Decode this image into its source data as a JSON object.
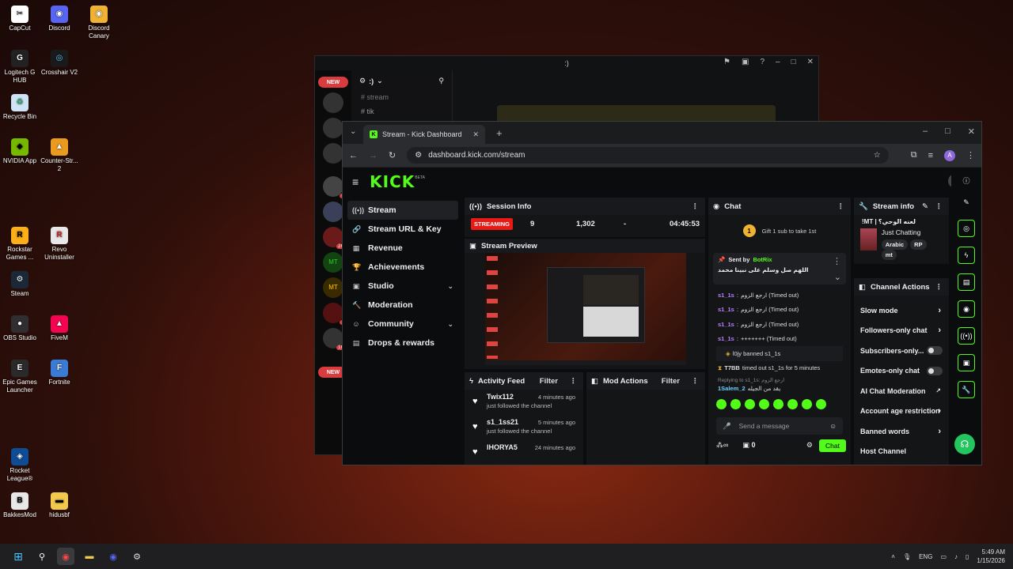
{
  "desktop": {
    "icons": [
      {
        "label": "CapCut",
        "glyph": "✂",
        "color": "#ffffff",
        "fg": "#000"
      },
      {
        "label": "Discord",
        "glyph": "◉",
        "color": "#5865f2",
        "fg": "#fff"
      },
      {
        "label": "Discord Canary",
        "glyph": "◉",
        "color": "#f0b232",
        "fg": "#fff"
      },
      {
        "label": "Logitech G HUB",
        "glyph": "G",
        "color": "#222222",
        "fg": "#fff"
      },
      {
        "label": "Crosshair V2",
        "glyph": "◎",
        "color": "#1a1a1a",
        "fg": "#6cf"
      },
      {
        "label": "Recycle Bin",
        "glyph": "♻",
        "color": "#cfe3f7",
        "fg": "#2a6"
      },
      {
        "label": "NVIDIA App",
        "glyph": "◆",
        "color": "#76b900",
        "fg": "#000"
      },
      {
        "label": "Counter-Str... 2",
        "glyph": "▲",
        "color": "#e99b20",
        "fg": "#fff"
      },
      {
        "label": "Rockstar Games ...",
        "glyph": "R",
        "color": "#fcaf17",
        "fg": "#000"
      },
      {
        "label": "Revo Uninstaller",
        "glyph": "R",
        "color": "#e8e8e8",
        "fg": "#c22"
      },
      {
        "label": "Steam",
        "glyph": "⚙",
        "color": "#1b2838",
        "fg": "#fff"
      },
      {
        "label": "OBS Studio",
        "glyph": "●",
        "color": "#302e31",
        "fg": "#fff"
      },
      {
        "label": "FiveM",
        "glyph": "▲",
        "color": "#f40552",
        "fg": "#fff"
      },
      {
        "label": "Epic Games Launcher",
        "glyph": "E",
        "color": "#2a2a2a",
        "fg": "#fff"
      },
      {
        "label": "Fortnite",
        "glyph": "F",
        "color": "#3a7bd5",
        "fg": "#fff"
      },
      {
        "label": "Rocket League®",
        "glyph": "◈",
        "color": "#0e4c96",
        "fg": "#fff"
      },
      {
        "label": "BakkesMod",
        "glyph": "B",
        "color": "#e8e8e8",
        "fg": "#000"
      },
      {
        "label": "hidusbf",
        "glyph": "▬",
        "color": "#f2c94c",
        "fg": "#000"
      }
    ]
  },
  "taskbar": {
    "tray_lang": "ENG",
    "time": "5:49 AM",
    "date": "1/15/2026"
  },
  "discord": {
    "title": ":)",
    "server_name": ":)",
    "channel_1": "stream",
    "channel_2": "tik",
    "badge_new_1": "NEW",
    "badge_new_2": "NEW",
    "badge_80": "80",
    "badge_2k": "2K+",
    "badge_24": "24",
    "badge_1k": "1K+"
  },
  "chrome": {
    "tab_title": "Stream - Kick Dashboard",
    "url": "dashboard.kick.com/stream",
    "profile_initial": "A"
  },
  "kick": {
    "logo": "KICK",
    "logo_beta": "BETA",
    "sidebar": [
      {
        "label": "Stream",
        "icon": "((•))",
        "chevron": ""
      },
      {
        "label": "Stream URL & Key",
        "icon": "🔗",
        "chevron": ""
      },
      {
        "label": "Revenue",
        "icon": "▦",
        "chevron": ""
      },
      {
        "label": "Achievements",
        "icon": "🏆",
        "chevron": ""
      },
      {
        "label": "Studio",
        "icon": "▣",
        "chevron": "⌄"
      },
      {
        "label": "Moderation",
        "icon": "🔨",
        "chevron": ""
      },
      {
        "label": "Community",
        "icon": "☺",
        "chevron": "⌄"
      },
      {
        "label": "Drops & rewards",
        "icon": "▤",
        "chevron": ""
      }
    ],
    "session": {
      "title": "Session Info",
      "status": "STREAMING",
      "viewers": "9",
      "followers": "1,302",
      "subs": "-",
      "duration": "04:45:53"
    },
    "preview": {
      "title": "Stream Preview"
    },
    "activity": {
      "title": "Activity Feed",
      "filter": "Filter",
      "items": [
        {
          "name": "Twix112",
          "sub": "just followed the channel",
          "time": "4 minutes ago"
        },
        {
          "name": "s1_1ss21",
          "sub": "just followed the channel",
          "time": "5 minutes ago"
        },
        {
          "name": "IHORYA5",
          "sub": "",
          "time": "24 minutes ago"
        }
      ]
    },
    "mod_actions": {
      "title": "Mod Actions",
      "filter": "Filter"
    },
    "chat": {
      "title": "Chat",
      "gift_text": "Gift 1 sub to take 1st",
      "gift_rank": "1",
      "pinned_label": "Sent by",
      "pinned_user": "BotRix",
      "pinned_msg": "اللهم صل وسلم على نبينا محمد",
      "lines": [
        {
          "user": "s1_1s",
          "msg": "ارجع الزوم (Timed out)"
        },
        {
          "user": "s1_1s",
          "msg": "ارجع الزوم (Timed out)"
        },
        {
          "user": "s1_1s",
          "msg": "ارجع الزوم (Timed out)"
        },
        {
          "user": "s1_1s",
          "msg": "+++++++ (Timed out)"
        }
      ],
      "mod1": "l0jy banned s1_1s",
      "mod2_user": "T7BB",
      "mod2": "timed out s1_1s for 5 minutes",
      "reply_label": "Replying to s1_1s: ارجع الزوم",
      "reply_user": "1Salem_2",
      "reply_msg": "يقد من الجيله",
      "placeholder": "Send a message",
      "count": "0",
      "send": "Chat"
    },
    "stream_info": {
      "title": "Stream info",
      "stream_title": "!MT | لعنه الوحي؟",
      "category": "Just Chatting",
      "tags": [
        "Arabic",
        "RP",
        "mt"
      ]
    },
    "channel_actions": {
      "title": "Channel Actions",
      "rows": [
        {
          "label": "Slow mode",
          "kind": "chevron"
        },
        {
          "label": "Followers-only chat",
          "kind": "chevron"
        },
        {
          "label": "Subscribers-only...",
          "kind": "toggle"
        },
        {
          "label": "Emotes-only chat",
          "kind": "toggle"
        },
        {
          "label": "AI Chat Moderation",
          "kind": "link"
        },
        {
          "label": "Account age restriction",
          "kind": "chevron"
        },
        {
          "label": "Banned words",
          "kind": "chevron"
        },
        {
          "label": "Host Channel",
          "kind": "none"
        }
      ]
    }
  }
}
